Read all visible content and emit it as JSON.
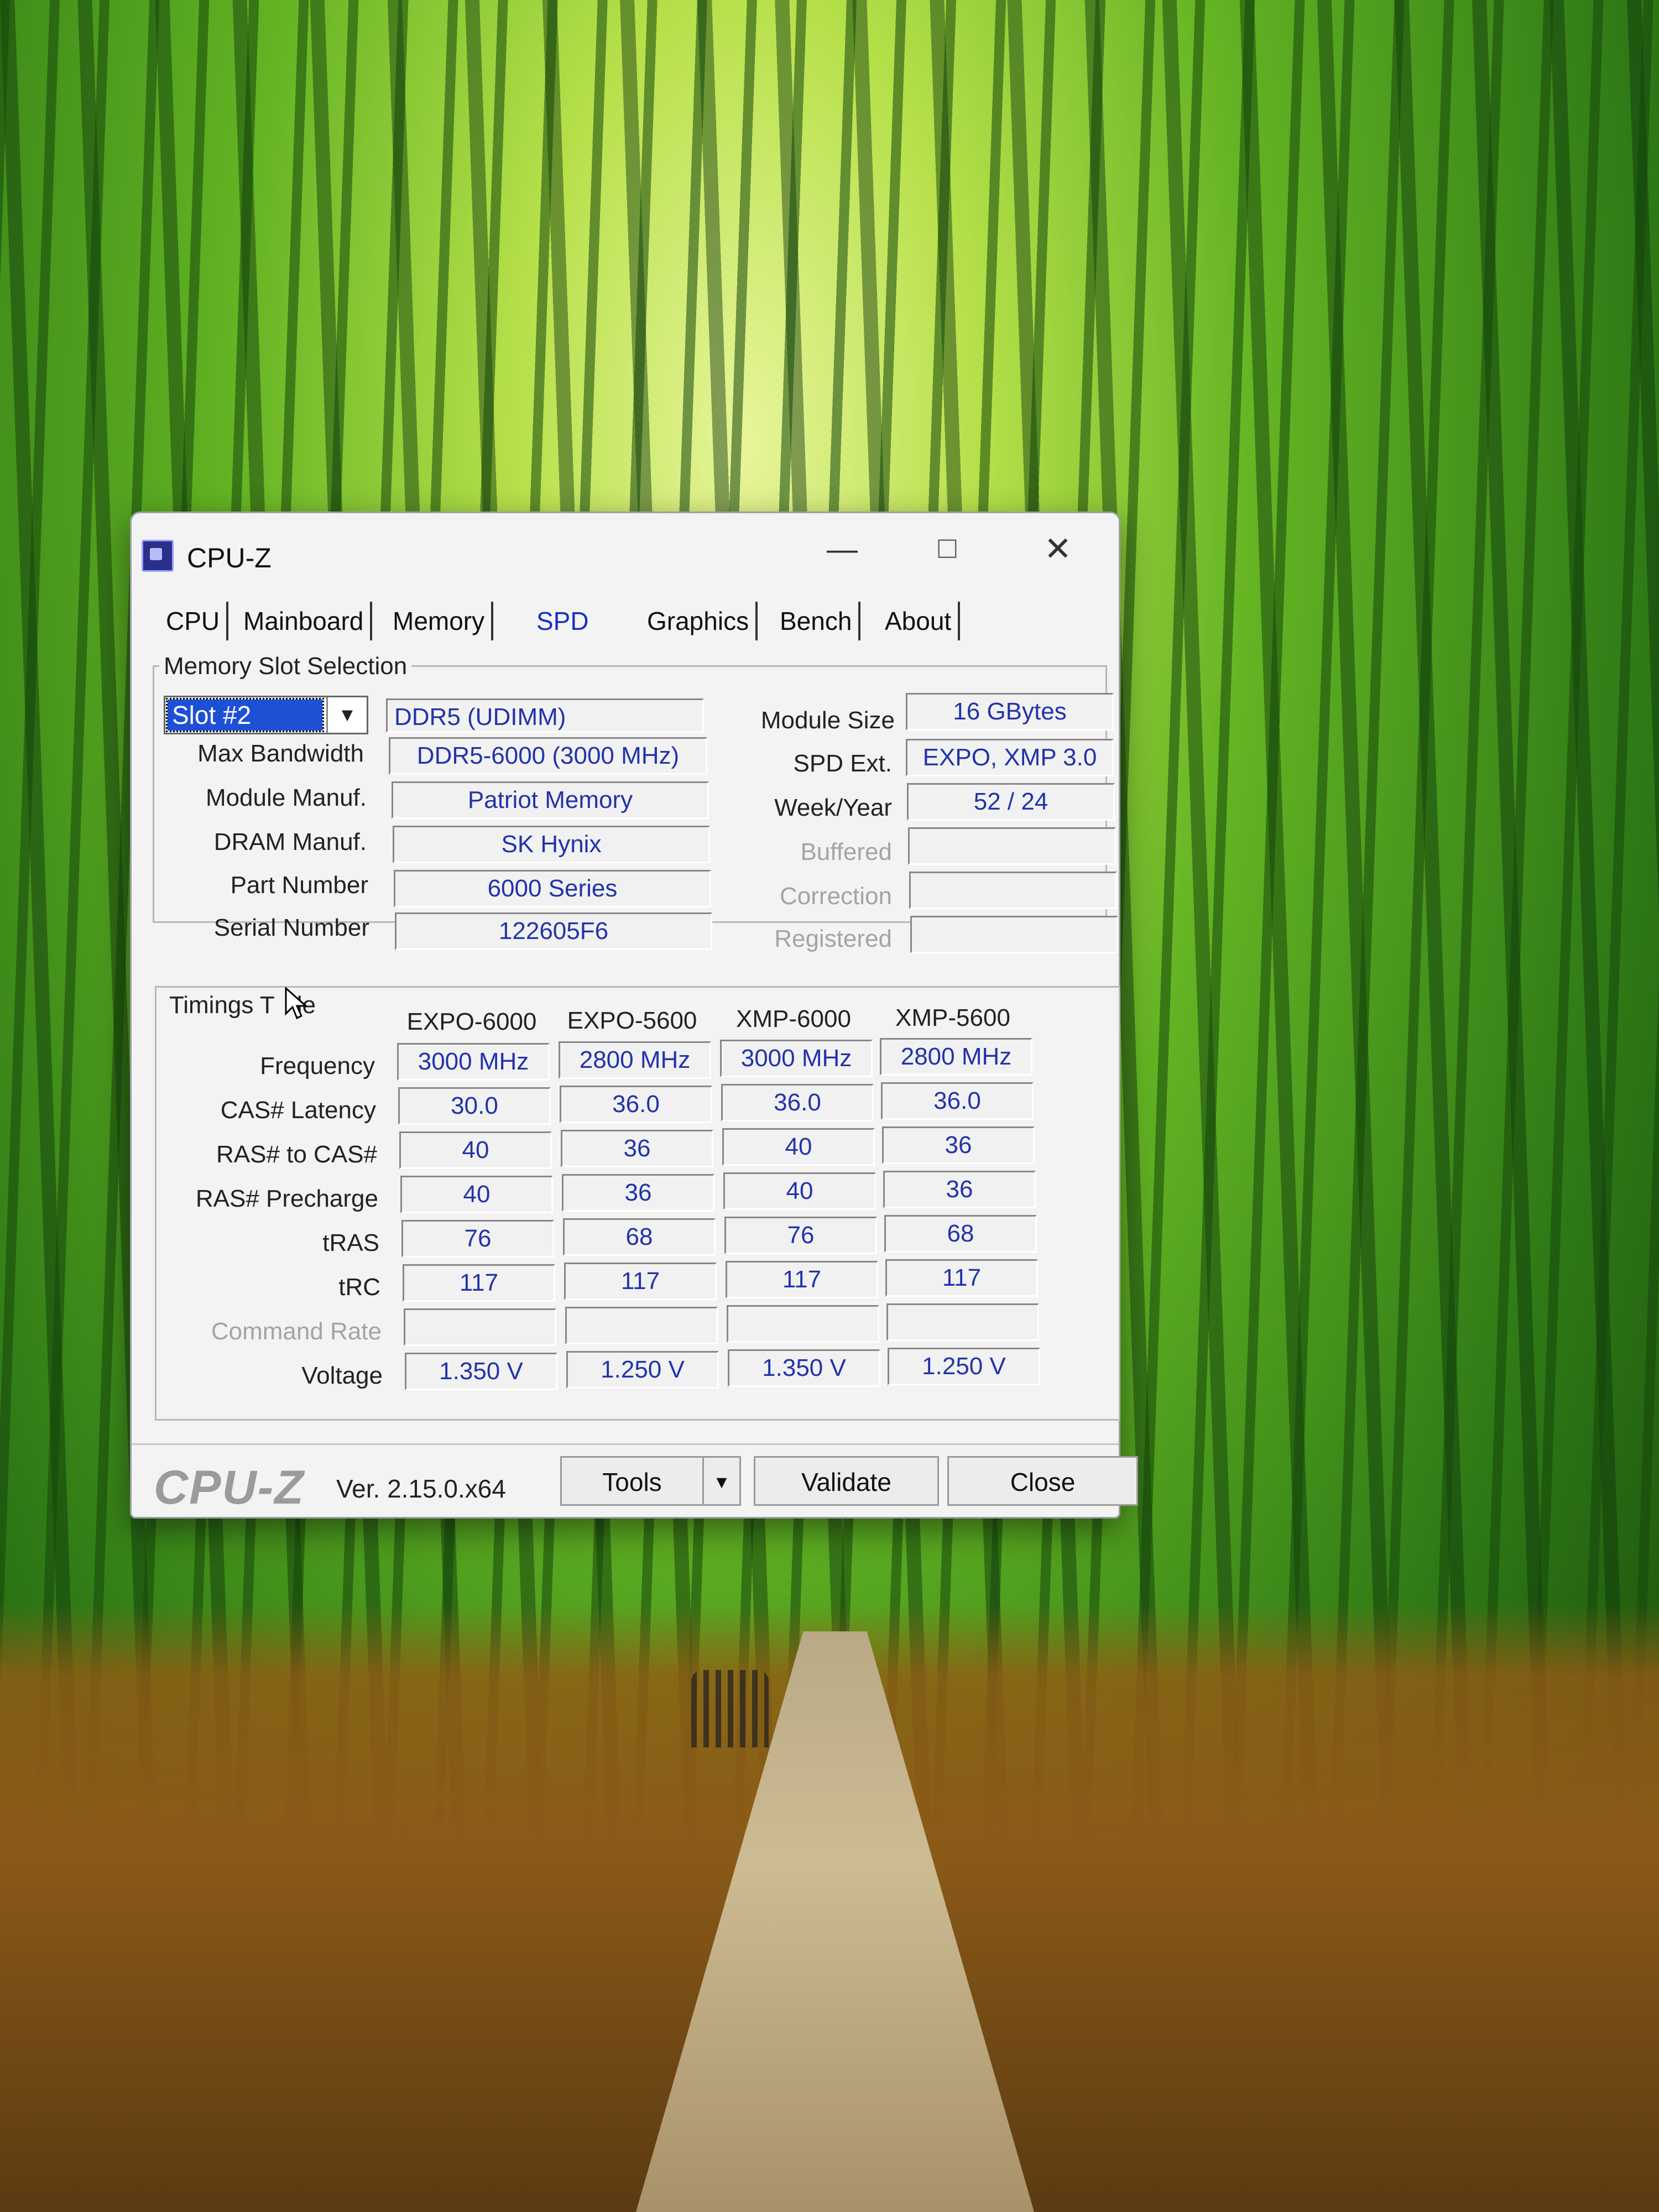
{
  "window": {
    "title": "CPU-Z",
    "controls": {
      "minimize": "—",
      "maximize": "☐",
      "close": "✕"
    }
  },
  "tabs": [
    "CPU",
    "Mainboard",
    "Memory",
    "SPD",
    "Graphics",
    "Bench",
    "About"
  ],
  "active_tab": "SPD",
  "memory_slot": {
    "group_label": "Memory Slot Selection",
    "slot": "Slot #2",
    "type": "DDR5 (UDIMM)",
    "rows": [
      {
        "label": "Max Bandwidth",
        "value": "DDR5-6000 (3000 MHz)"
      },
      {
        "label": "Module Manuf.",
        "value": "Patriot Memory"
      },
      {
        "label": "DRAM Manuf.",
        "value": "SK Hynix"
      },
      {
        "label": "Part Number",
        "value": "6000 Series"
      },
      {
        "label": "Serial Number",
        "value": "122605F6"
      }
    ],
    "right": [
      {
        "label": "Module Size",
        "value": "16 GBytes",
        "dim": false
      },
      {
        "label": "SPD Ext.",
        "value": "EXPO, XMP 3.0",
        "dim": false
      },
      {
        "label": "Week/Year",
        "value": "52 / 24",
        "dim": false
      },
      {
        "label": "Buffered",
        "value": "",
        "dim": true
      },
      {
        "label": "Correction",
        "value": "",
        "dim": true
      },
      {
        "label": "Registered",
        "value": "",
        "dim": true
      }
    ]
  },
  "timings": {
    "group_label": "Timings T",
    "group_label_tail": "le",
    "columns": [
      "EXPO-6000",
      "EXPO-5600",
      "XMP-6000",
      "XMP-5600"
    ],
    "rows": [
      {
        "label": "Frequency",
        "dim": false,
        "values": [
          "3000 MHz",
          "2800 MHz",
          "3000 MHz",
          "2800 MHz"
        ]
      },
      {
        "label": "CAS# Latency",
        "dim": false,
        "values": [
          "30.0",
          "36.0",
          "36.0",
          "36.0"
        ]
      },
      {
        "label": "RAS# to CAS#",
        "dim": false,
        "values": [
          "40",
          "36",
          "40",
          "36"
        ]
      },
      {
        "label": "RAS# Precharge",
        "dim": false,
        "values": [
          "40",
          "36",
          "40",
          "36"
        ]
      },
      {
        "label": "tRAS",
        "dim": false,
        "values": [
          "76",
          "68",
          "76",
          "68"
        ]
      },
      {
        "label": "tRC",
        "dim": false,
        "values": [
          "117",
          "117",
          "117",
          "117"
        ]
      },
      {
        "label": "Command Rate",
        "dim": true,
        "values": [
          "",
          "",
          "",
          ""
        ]
      },
      {
        "label": "Voltage",
        "dim": false,
        "values": [
          "1.350 V",
          "1.250 V",
          "1.350 V",
          "1.250 V"
        ]
      }
    ]
  },
  "footer": {
    "brand": "CPU-Z",
    "version": "Ver. 2.15.0.x64",
    "tools": "Tools",
    "validate": "Validate",
    "close": "Close"
  }
}
